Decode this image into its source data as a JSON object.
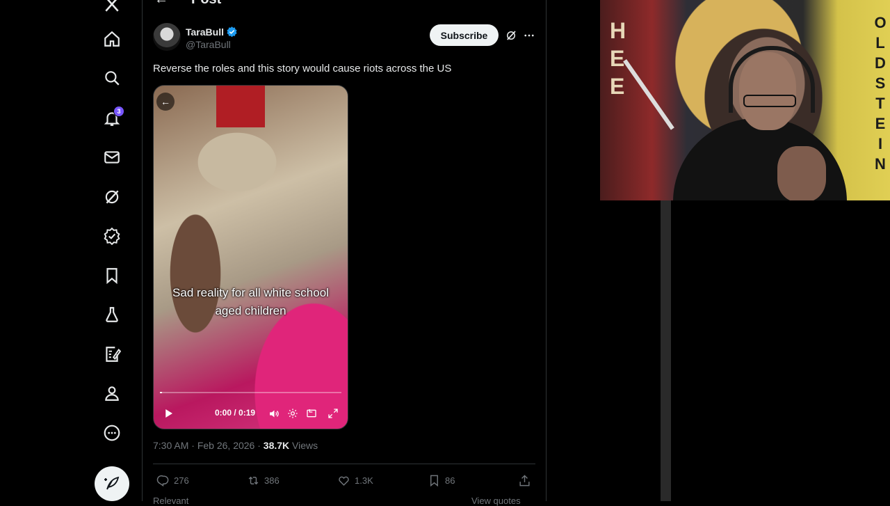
{
  "header": {
    "title": "Post"
  },
  "nav": {
    "items": [
      {
        "name": "x-logo-icon"
      },
      {
        "name": "home-icon"
      },
      {
        "name": "explore-icon"
      },
      {
        "name": "notifications-icon",
        "badge": "3"
      },
      {
        "name": "messages-icon"
      },
      {
        "name": "grok-icon"
      },
      {
        "name": "premium-icon"
      },
      {
        "name": "bookmarks-icon"
      },
      {
        "name": "jobs-icon"
      },
      {
        "name": "articles-icon"
      },
      {
        "name": "profile-icon"
      },
      {
        "name": "more-icon"
      }
    ],
    "compose_icon": "compose-post-icon"
  },
  "post": {
    "author_name": "TaraBull",
    "author_handle": "@TaraBull",
    "subscribe_label": "Subscribe",
    "text": "Reverse the roles and this story would cause riots across the US",
    "video": {
      "caption_line1": "Sad reality for all white school",
      "caption_line2": "aged children",
      "time": "0:00 / 0:19",
      "progress": 0.0
    },
    "meta": {
      "time": "7:30 AM",
      "date": "Feb 26, 2026",
      "views_count": "38.7K",
      "views_label": "Views"
    },
    "actions": {
      "replies": "276",
      "reposts": "386",
      "likes": "1.3K",
      "bookmarks": "86"
    }
  },
  "replies_bar": {
    "sort_label": "Relevant",
    "quotes_label": "View quotes"
  },
  "webcam": {
    "left_letters": [
      "H",
      "E",
      "E"
    ],
    "right_letters": [
      "O",
      "L",
      "D",
      "S",
      "T",
      "E",
      "I",
      "N"
    ]
  },
  "colors": {
    "accent": "#1d9bf0",
    "badge": "#7856ff",
    "verified": "#1d9bf0"
  }
}
